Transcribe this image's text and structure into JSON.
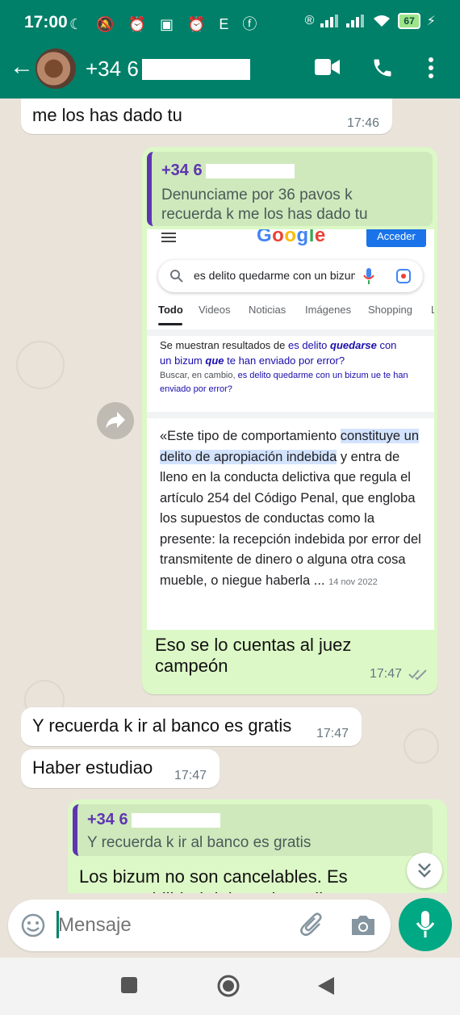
{
  "status_bar": {
    "time": "17:00",
    "left_icons": "☾ 🔕 ⏰ ▣ ⏰ E ⓕ",
    "battery": "67"
  },
  "header": {
    "back_icon": "arrow-left-icon",
    "contact_name": "+34 6",
    "video_icon": "video-call-icon",
    "call_icon": "phone-icon",
    "menu_icon": "more-vert-icon",
    "color": "#008069"
  },
  "messages": [
    {
      "direction": "in",
      "text_partial_top": "me los has dado tu",
      "time": "17:46"
    },
    {
      "direction": "out",
      "quote": {
        "name": "+34 6",
        "text": "Denunciame por 36 pavos k recuerda k me los has dado tu"
      },
      "image": {
        "google_logo": "Google",
        "acceder": "Acceder",
        "search_query": "es delito quedarme con un bizum",
        "tabs": [
          "Todo",
          "Videos",
          "Noticias",
          "Imágenes",
          "Shopping",
          "L"
        ],
        "correction": {
          "line1_prefix": "Se muestran resultados de ",
          "line1_link_a": "es delito ",
          "line1_link_b": "quedarse",
          "line1_link_c": " con",
          "line2_link_a": "un bizum ",
          "line2_link_b": "que",
          "line2_link_c": " te han enviado por error?",
          "instead_prefix": "Buscar, en cambio, ",
          "instead_link": "es delito quedarme con un bizum ue te han enviado por error?"
        },
        "snippet": {
          "open": "«Este tipo de comportamiento ",
          "highlight": "constituye un delito de apropiación indebida",
          "rest": " y entra de lleno en la conducta delictiva que regula el artículo 254 del Código Penal, que engloba los supuestos de conductas como la presente: la recepción indebida por error del transmitente de dinero o alguna otra cosa mueble, o niegue haberla ...",
          "date": "14 nov 2022"
        }
      },
      "text": "Eso se lo cuentas al juez campeón",
      "time": "17:47"
    },
    {
      "direction": "in",
      "text": "Y recuerda k ir al banco es gratis",
      "time": "17:47"
    },
    {
      "direction": "in",
      "text": "Haber estudiao",
      "time": "17:47"
    },
    {
      "direction": "out",
      "quote": {
        "name": "+34 6",
        "text": "Y recuerda k ir al banco es gratis"
      },
      "text": "Los bizum no son cancelables. Es responsabilidad del que lo recibe"
    }
  ],
  "input": {
    "placeholder": "Mensaje",
    "emoji_icon": "emoji-icon",
    "attach_icon": "paperclip-icon",
    "camera_icon": "camera-icon",
    "mic_icon": "mic-icon"
  },
  "nav": {
    "recents_icon": "square-icon",
    "home_icon": "circle-icon",
    "back_icon": "triangle-back-icon"
  }
}
